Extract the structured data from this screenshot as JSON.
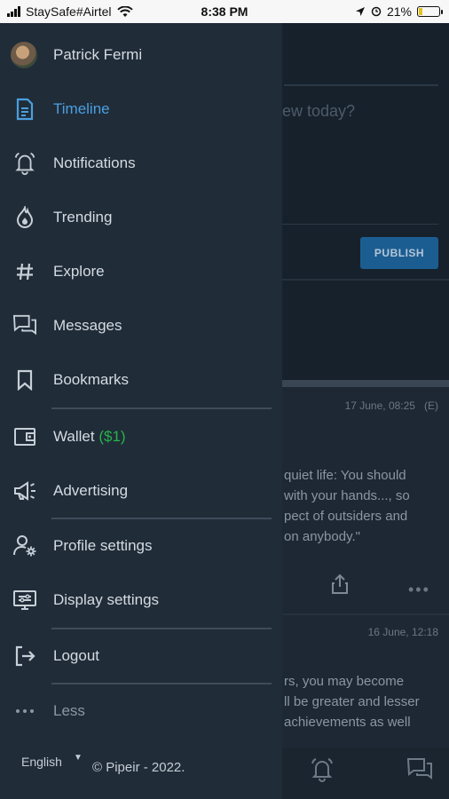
{
  "status_bar": {
    "carrier": "StaySafe#Airtel",
    "time": "8:38 PM",
    "battery": "21%",
    "battery_level": 0.21
  },
  "background": {
    "composer_placeholder": "ew today?",
    "publish_label": "PUBLISH",
    "post1": {
      "date": "17 June, 08:25",
      "flag": "(E)",
      "lines": [
        "quiet life: You should",
        " with your hands..., so",
        "pect of outsiders and",
        "on anybody.\""
      ]
    },
    "post2": {
      "date": "16 June, 12:18",
      "lines": [
        "rs, you may become",
        "ll be greater and lesser",
        "achievements as well"
      ]
    }
  },
  "drawer": {
    "user_name": "Patrick Fermi",
    "items": [
      {
        "label": "Timeline",
        "icon": "document-icon",
        "active": true
      },
      {
        "label": "Notifications",
        "icon": "bell-icon"
      },
      {
        "label": "Trending",
        "icon": "flame-icon"
      },
      {
        "label": "Explore",
        "icon": "hashtag-icon"
      },
      {
        "label": "Messages",
        "icon": "chat-icon"
      },
      {
        "label": "Bookmarks",
        "icon": "bookmark-icon"
      },
      {
        "label": "Wallet",
        "extra": "($1)",
        "icon": "wallet-icon"
      },
      {
        "label": "Advertising",
        "icon": "megaphone-icon"
      },
      {
        "label": "Profile settings",
        "icon": "user-settings-icon"
      },
      {
        "label": "Display settings",
        "icon": "display-icon"
      },
      {
        "label": "Logout",
        "icon": "logout-icon"
      },
      {
        "label": "Less",
        "icon": "ellipsis-icon"
      }
    ],
    "language": "English",
    "copyright": "© Pipeir - 2022."
  },
  "colors": {
    "drawer_bg": "#202c38",
    "accent": "#4a9fe0",
    "wallet_amount": "#29b34a",
    "publish_bg": "#1c5d91"
  }
}
